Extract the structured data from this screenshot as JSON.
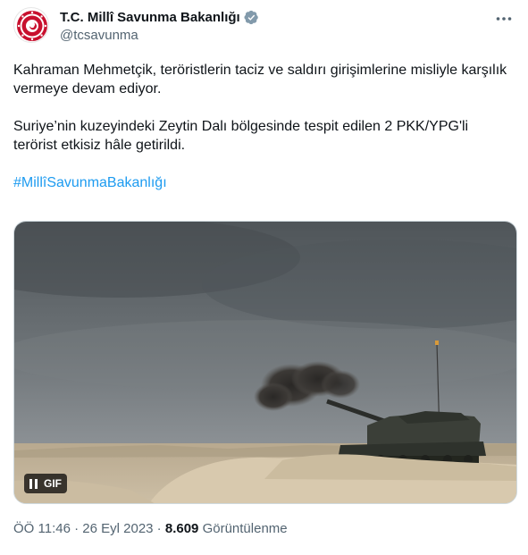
{
  "author": {
    "display_name": "T.C. Millî Savunma Bakanlığı",
    "handle": "@tcsavunma"
  },
  "tweet": {
    "paragraph1": "Kahraman Mehmetçik, teröristlerin taciz ve saldırı girişimlerine misliyle karşılık vermeye devam ediyor.",
    "paragraph2": "Suriye’nin kuzeyindeki Zeytin Dalı bölgesinde tespit edilen 2 PKK/YPG'li terörist etkisiz hâle getirildi.",
    "hashtag": "#MillîSavunmaBakanlığı"
  },
  "media": {
    "badge": "GIF"
  },
  "meta": {
    "time": "ÖÖ 11:46",
    "sep1": " · ",
    "date": "26 Eyl 2023",
    "sep2": " · ",
    "views_count": "8.609",
    "views_label": " Görüntülenme"
  },
  "icons": {
    "verified": "verified-badge-icon",
    "more": "more-dots-icon",
    "pause": "pause-icon",
    "avatar": "ministry-emblem-avatar"
  },
  "colors": {
    "accent": "#1d9bf0",
    "verified": "#829aab",
    "emblem_red": "#c8102e"
  }
}
